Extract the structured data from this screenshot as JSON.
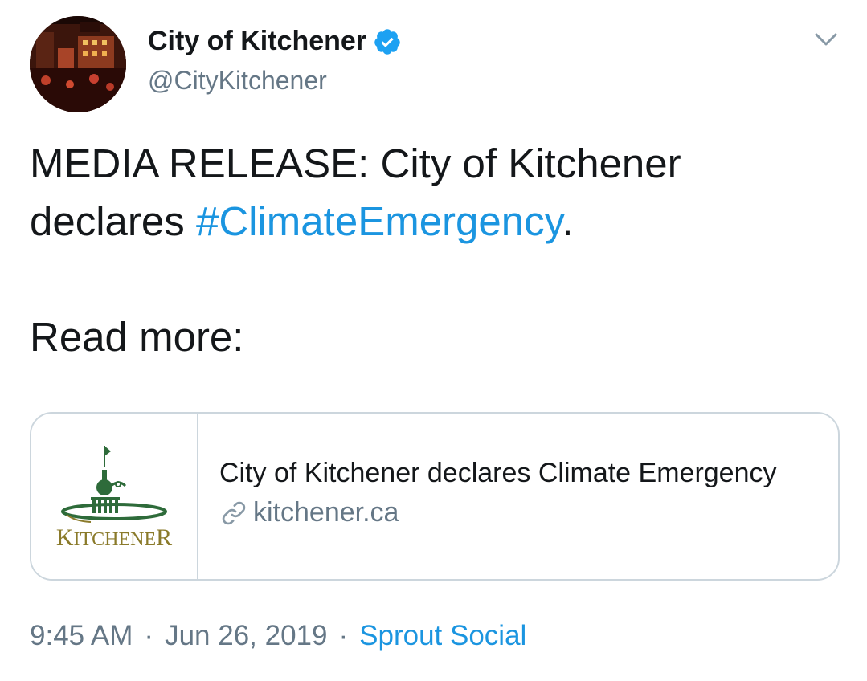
{
  "author": {
    "display_name": "City of Kitchener",
    "handle": "@CityKitchener",
    "verified": true
  },
  "tweet": {
    "text_line1": "MEDIA RELEASE: City of Kitchener",
    "text_line2_prefix": "declares ",
    "hashtag": "#ClimateEmergency",
    "text_line2_suffix": ".",
    "read_more": "Read more:"
  },
  "card": {
    "title": "City of Kitchener declares Climate Emergency",
    "domain": "kitchener.ca",
    "logo_text": "KITCHENER"
  },
  "meta": {
    "time": "9:45 AM",
    "separator": "·",
    "date": "Jun 26, 2019",
    "source": "Sprout Social"
  },
  "colors": {
    "link_blue": "#1b95e0",
    "secondary_gray": "#657786",
    "border": "#ccd6dd",
    "logo_green": "#2e6b3a",
    "logo_gold": "#8a7a2a"
  }
}
